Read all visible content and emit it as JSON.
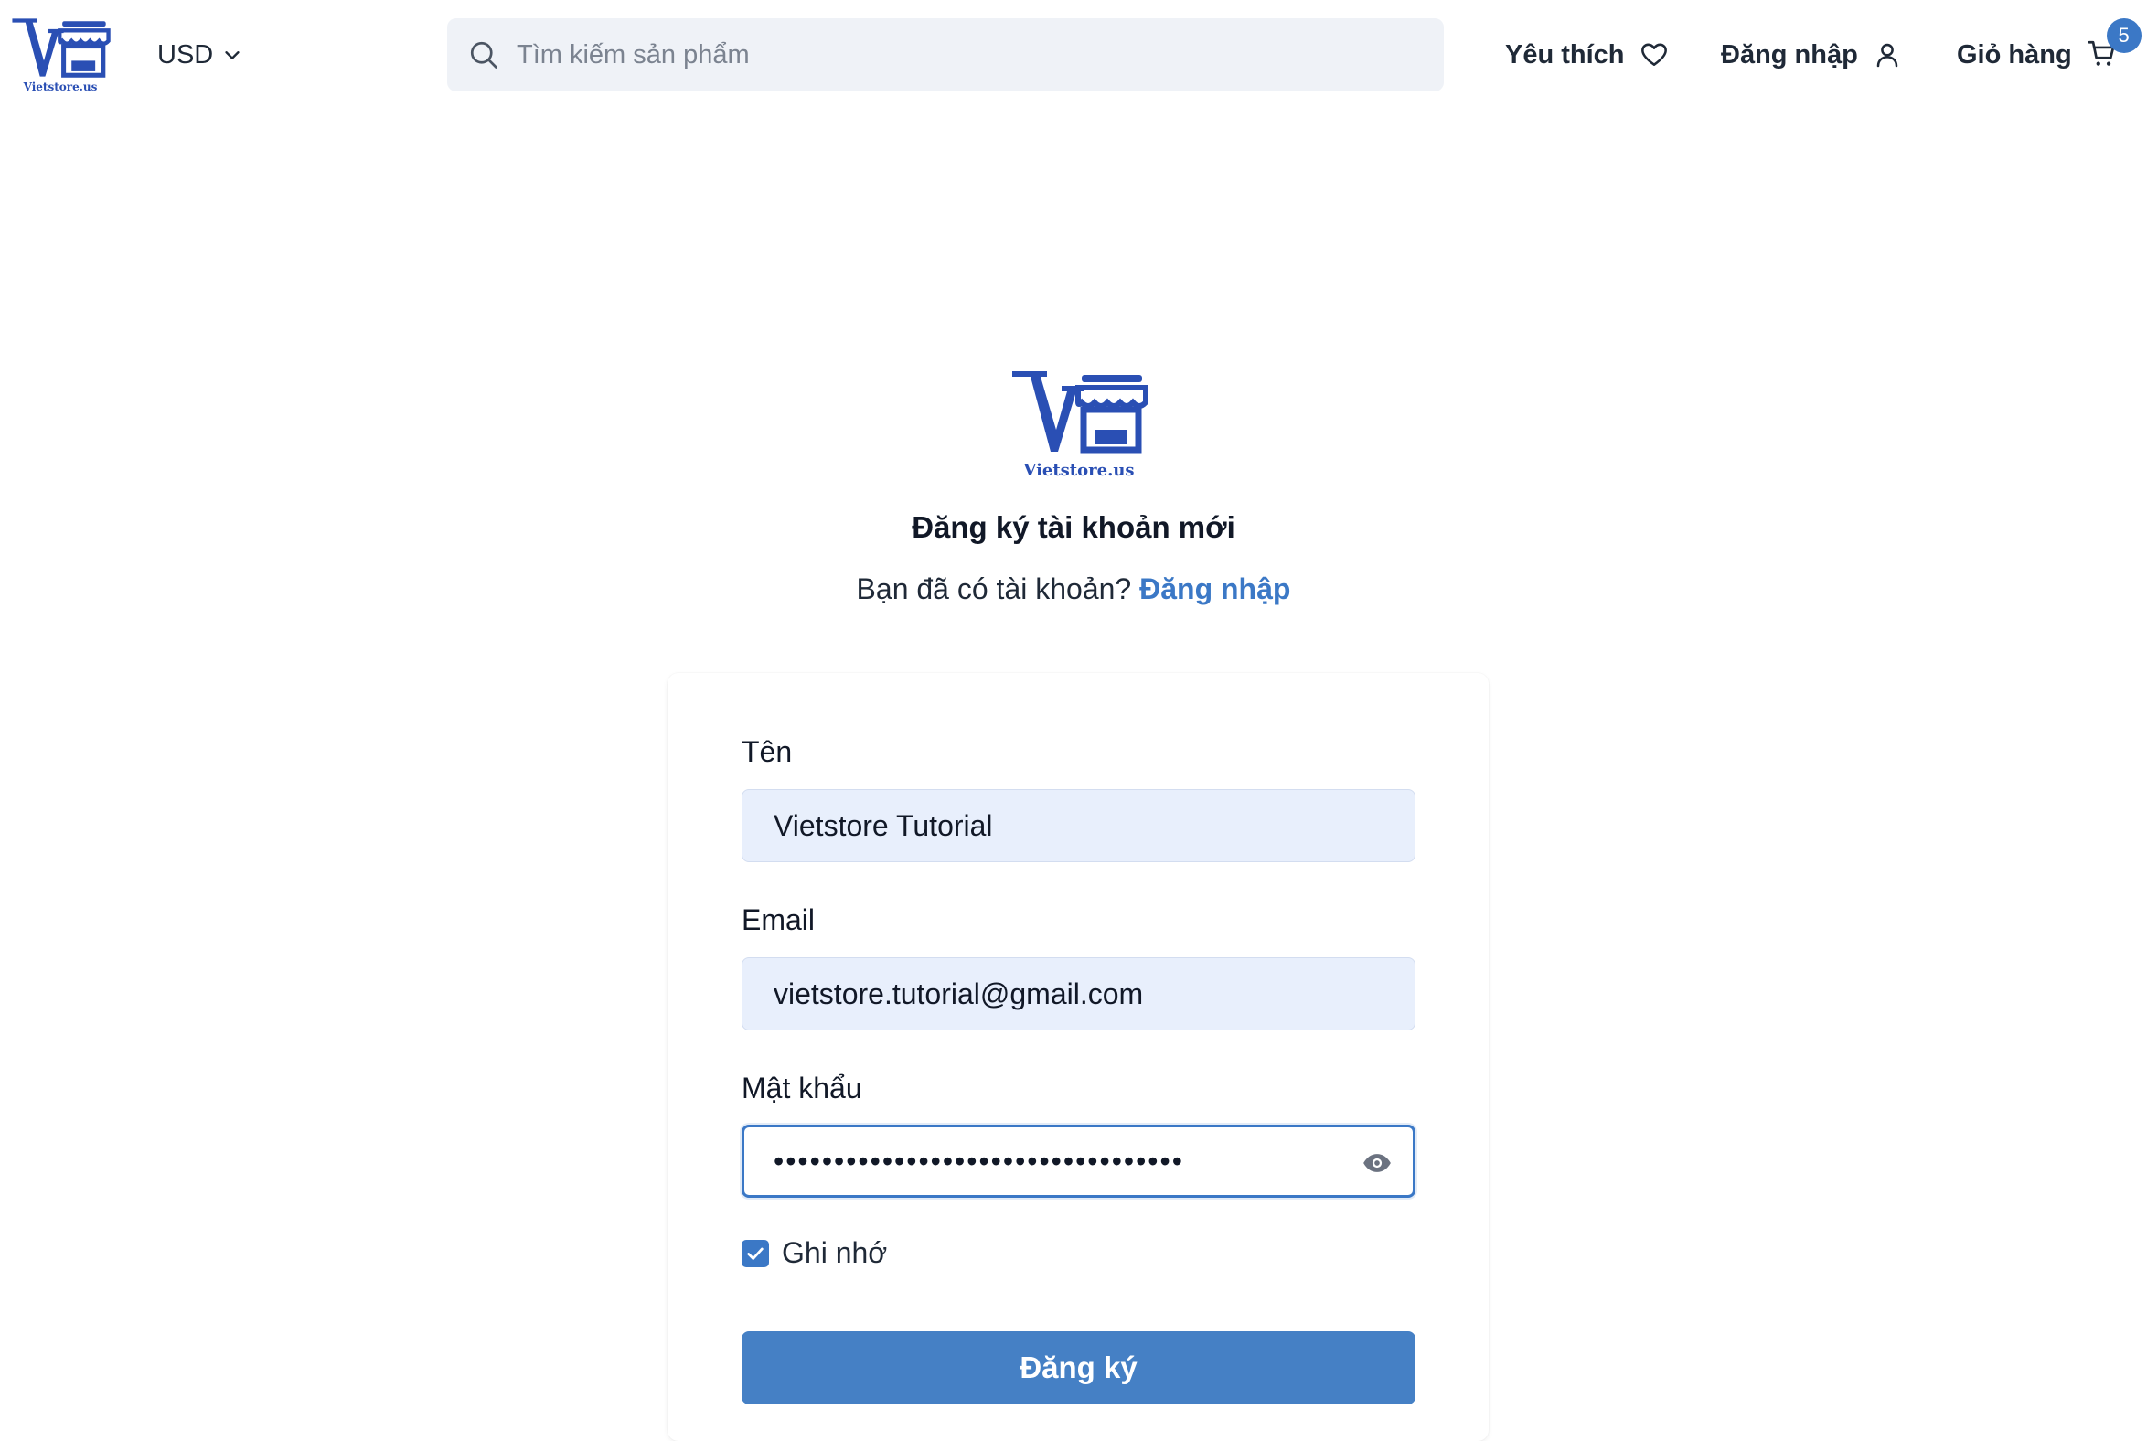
{
  "brand": {
    "name": "Vietstore.us",
    "color": "#2a4fb4"
  },
  "header": {
    "currency": "USD",
    "search_placeholder": "Tìm kiếm sản phẩm",
    "favorites_label": "Yêu thích",
    "login_label": "Đăng nhập",
    "cart_label": "Giỏ hàng",
    "cart_count": "5"
  },
  "form": {
    "title": "Đăng ký tài khoản mới",
    "have_account_text": "Bạn đã có tài khoản?",
    "login_link": "Đăng nhập",
    "name_label": "Tên",
    "name_value": "Vietstore Tutorial",
    "email_label": "Email",
    "email_value": "vietstore.tutorial@gmail.com",
    "password_label": "Mật khẩu",
    "password_value": "••••••••••••••••••••••••••••••••••",
    "remember_label": "Ghi nhớ",
    "remember_checked": true,
    "submit_label": "Đăng ký"
  },
  "colors": {
    "accent": "#3b78c6",
    "input_bg": "#e8effc",
    "search_bg": "#eff2f7"
  }
}
